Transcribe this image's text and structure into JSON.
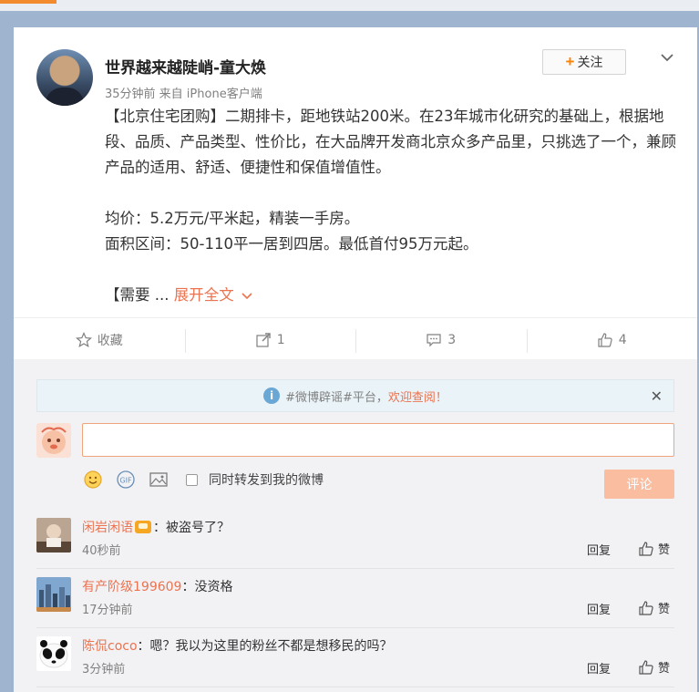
{
  "post": {
    "author": "世界越来越陡峭-童大焕",
    "meta": "35分钟前 来自 iPhone客户端",
    "follow_label": "关注",
    "paragraphs": [
      "【北京住宅团购】二期排卡，距地铁站200米。在23年城市化研究的基础上，根据地段、品质、产品类型、性价比，在大品牌开发商北京众多产品里，只挑选了一个，兼顾产品的适用、舒适、便捷性和保值增值性。",
      "",
      "均价：5.2万元/平米起，精装一手房。",
      "面积区间：50-110平一居到四居。最低首付95万元起。",
      ""
    ],
    "truncated_text": "【需要 ...",
    "expand_label": "展开全文"
  },
  "actions": {
    "favorite_label": "收藏",
    "repost_count": "1",
    "comment_count": "3",
    "like_count": "4"
  },
  "notice": {
    "prefix": "#微博辟谣#平台，",
    "link": "欢迎查阅！"
  },
  "composer": {
    "input_value": "",
    "repost_checkbox_label": "同时转发到我的微博",
    "submit_label": "评论"
  },
  "comments": [
    {
      "user": "闲岩闲语",
      "text": "：被盗号了？",
      "time": "40秒前",
      "reply": "回复",
      "like": "赞"
    },
    {
      "user": "有产阶级199609",
      "text": "：没资格",
      "time": "17分钟前",
      "reply": "回复",
      "like": "赞"
    },
    {
      "user": "陈侃coco",
      "text": "：嗯？我以为这里的粉丝不都是想移民的吗？",
      "time": "3分钟前",
      "reply": "回复",
      "like": "赞"
    }
  ],
  "colors": {
    "accent": "#ff8200",
    "link": "#eb7350",
    "page_background": "#9fb5cf"
  }
}
